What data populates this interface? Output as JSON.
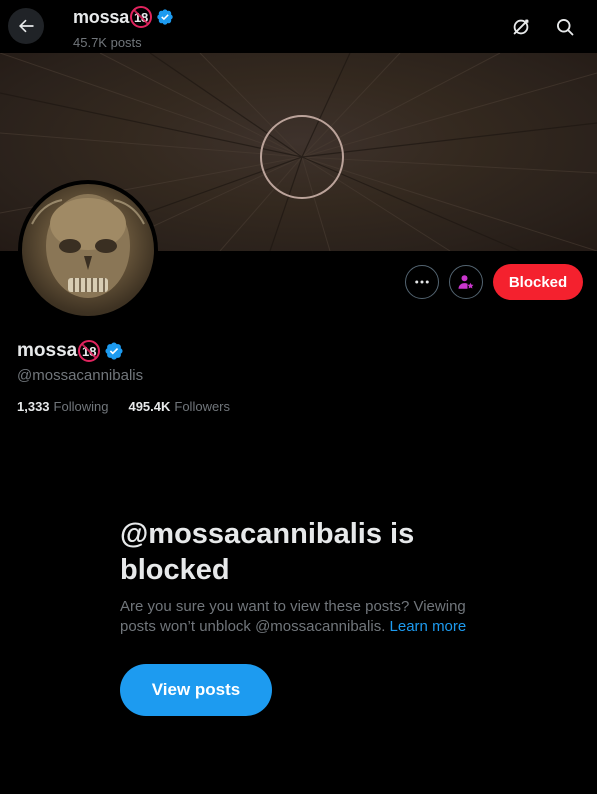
{
  "header": {
    "display_name": "mossa",
    "age_badge": "18",
    "post_count": "45.7K posts",
    "back_icon": "arrow-left-icon",
    "grok_icon": "grok-icon",
    "search_icon": "search-icon"
  },
  "profile": {
    "display_name": "mossa",
    "age_badge": "18",
    "handle": "@mossacannibalis",
    "following_count": "1,333",
    "following_label": "Following",
    "followers_count": "495.4K",
    "followers_label": "Followers",
    "verified_color": "#1d9bf0"
  },
  "actions": {
    "more_icon": "more-horizontal-icon",
    "subscribe_icon": "subscribe-user-icon",
    "blocked_label": "Blocked",
    "blocked_color": "#f4212e"
  },
  "blocked_notice": {
    "title": "@mossacannibalis is blocked",
    "description": "Are you sure you want to view these posts? Viewing posts won’t unblock @mossacannibalis.",
    "learn_more": "Learn more",
    "view_posts_label": "View posts",
    "accent_color": "#1d9bf0"
  }
}
